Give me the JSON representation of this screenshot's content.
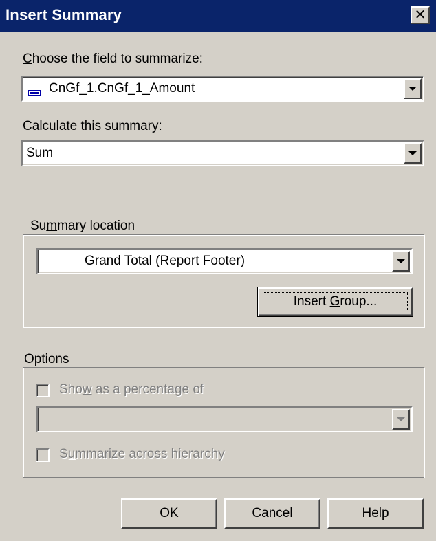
{
  "dialog": {
    "title": "Insert Summary",
    "close_glyph": "✕"
  },
  "field": {
    "label_pre": "",
    "label_u": "C",
    "label_post": "hoose the field to summarize:",
    "value": "CnGf_1.CnGf_1_Amount",
    "icon": "database-field-icon"
  },
  "calculate": {
    "label_pre": "C",
    "label_u": "a",
    "label_post": "lculate this summary:",
    "value": "Sum"
  },
  "summary_location": {
    "legend_pre": "Su",
    "legend_u": "m",
    "legend_post": "mary location",
    "value": "Grand Total (Report Footer)",
    "insert_group_pre": "Insert ",
    "insert_group_u": "G",
    "insert_group_post": "roup..."
  },
  "options": {
    "legend": "Options",
    "show_percentage_pre": "Sho",
    "show_percentage_u": "w",
    "show_percentage_post": " as a percentage of",
    "show_percentage_checked": false,
    "percentage_value": "",
    "summarize_hierarchy_pre": "S",
    "summarize_hierarchy_u": "u",
    "summarize_hierarchy_post": "mmarize across hierarchy",
    "summarize_hierarchy_checked": false
  },
  "buttons": {
    "ok": "OK",
    "cancel": "Cancel",
    "help_u": "H",
    "help_post": "elp"
  },
  "colors": {
    "titlebar": "#0a246a",
    "face": "#d4d0c8",
    "disabled_text": "#808080"
  }
}
